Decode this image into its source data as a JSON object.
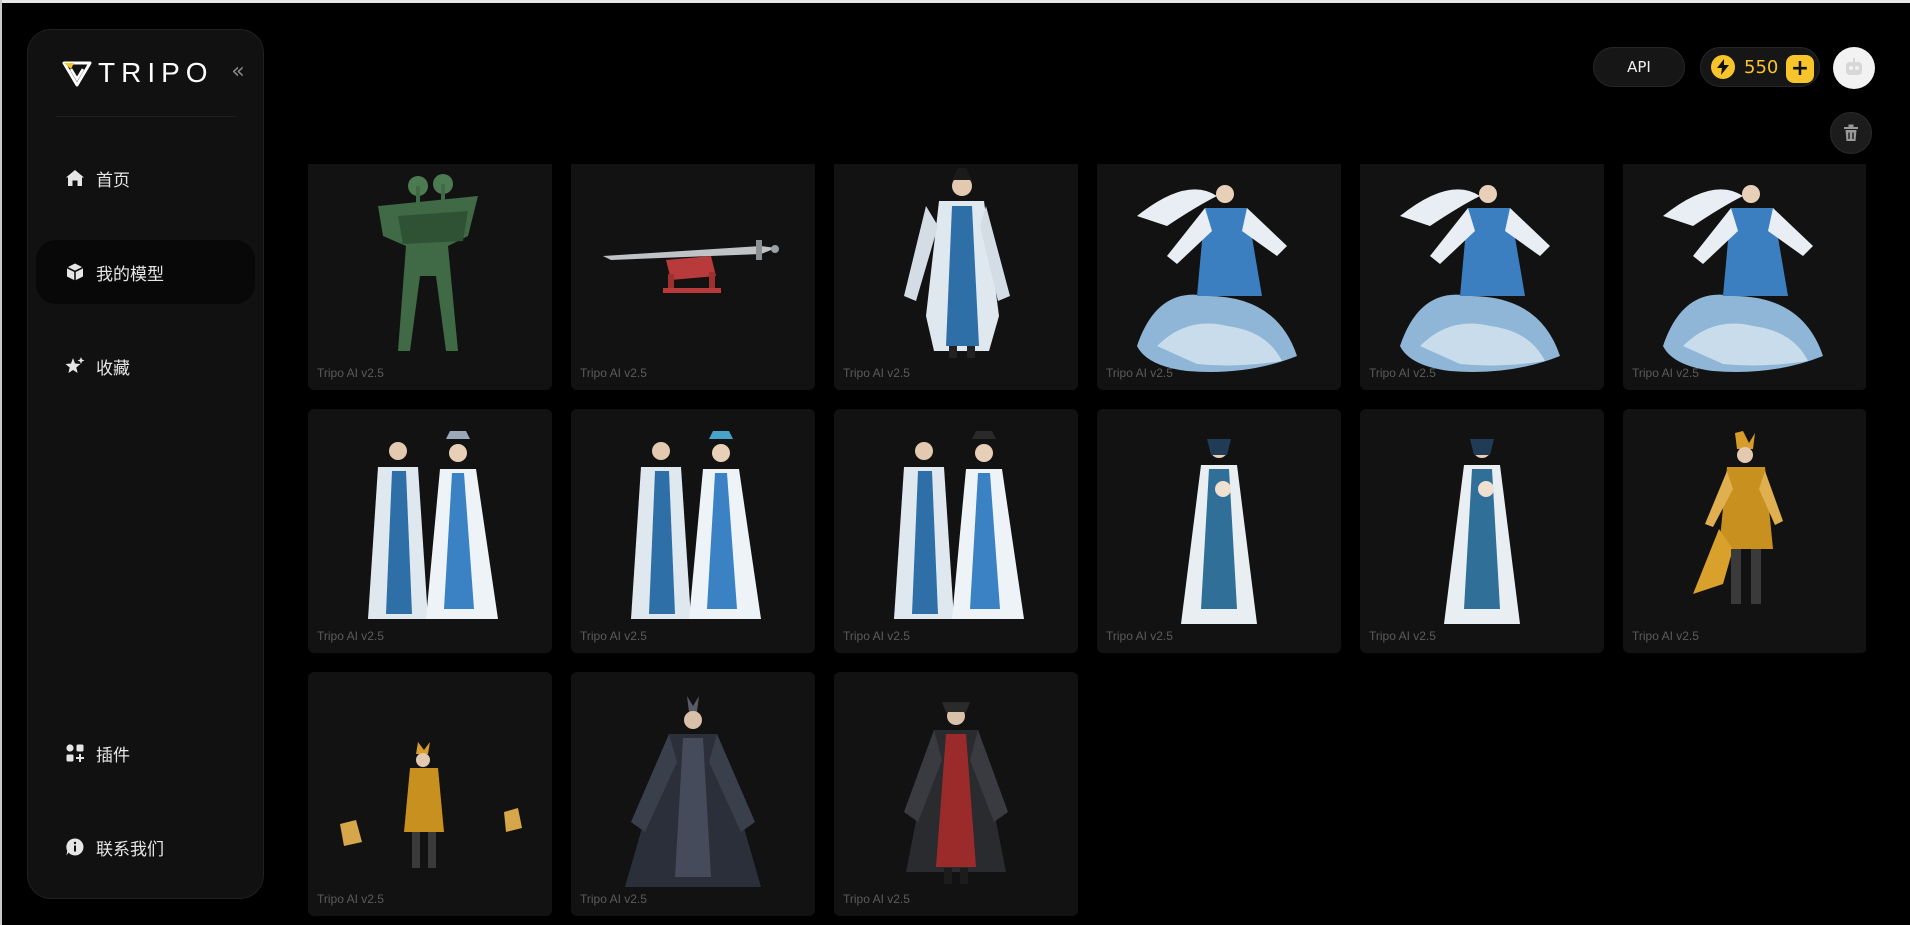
{
  "brand": {
    "name": "TRIPO"
  },
  "sidebar": {
    "collapse_glyph": "«",
    "items": [
      {
        "label": "首页",
        "icon": "home-icon",
        "active": false
      },
      {
        "label": "我的模型",
        "icon": "cube-icon",
        "active": true
      },
      {
        "label": "收藏",
        "icon": "star-sparkle-icon",
        "active": false
      }
    ],
    "bottom_items": [
      {
        "label": "插件",
        "icon": "plugins-icon"
      },
      {
        "label": "联系我们",
        "icon": "info-bubble-icon"
      }
    ]
  },
  "topbar": {
    "api_label": "API",
    "credits": "550",
    "plus_glyph": "+",
    "accent": "#f7c52b"
  },
  "models": [
    {
      "caption": "Tripo AI v2.5",
      "subject": "green bronze vessel"
    },
    {
      "caption": "Tripo AI v2.5",
      "subject": "sword on red stand"
    },
    {
      "caption": "Tripo AI v2.5",
      "subject": "man in blue robes"
    },
    {
      "caption": "Tripo AI v2.5",
      "subject": "white-haired figure on wave"
    },
    {
      "caption": "Tripo AI v2.5",
      "subject": "white-haired figure on wave"
    },
    {
      "caption": "Tripo AI v2.5",
      "subject": "white-haired figure on wave"
    },
    {
      "caption": "Tripo AI v2.5",
      "subject": "couple in blue and white robes"
    },
    {
      "caption": "Tripo AI v2.5",
      "subject": "couple in blue and white robes"
    },
    {
      "caption": "Tripo AI v2.5",
      "subject": "couple in blue and white robes"
    },
    {
      "caption": "Tripo AI v2.5",
      "subject": "woman holding child"
    },
    {
      "caption": "Tripo AI v2.5",
      "subject": "woman holding child"
    },
    {
      "caption": "Tripo AI v2.5",
      "subject": "warrior in golden armor"
    },
    {
      "caption": "Tripo AI v2.5",
      "subject": "golden figure with pieces"
    },
    {
      "caption": "Tripo AI v2.5",
      "subject": "dark armored figure"
    },
    {
      "caption": "Tripo AI v2.5",
      "subject": "figure in red and black robes"
    }
  ]
}
